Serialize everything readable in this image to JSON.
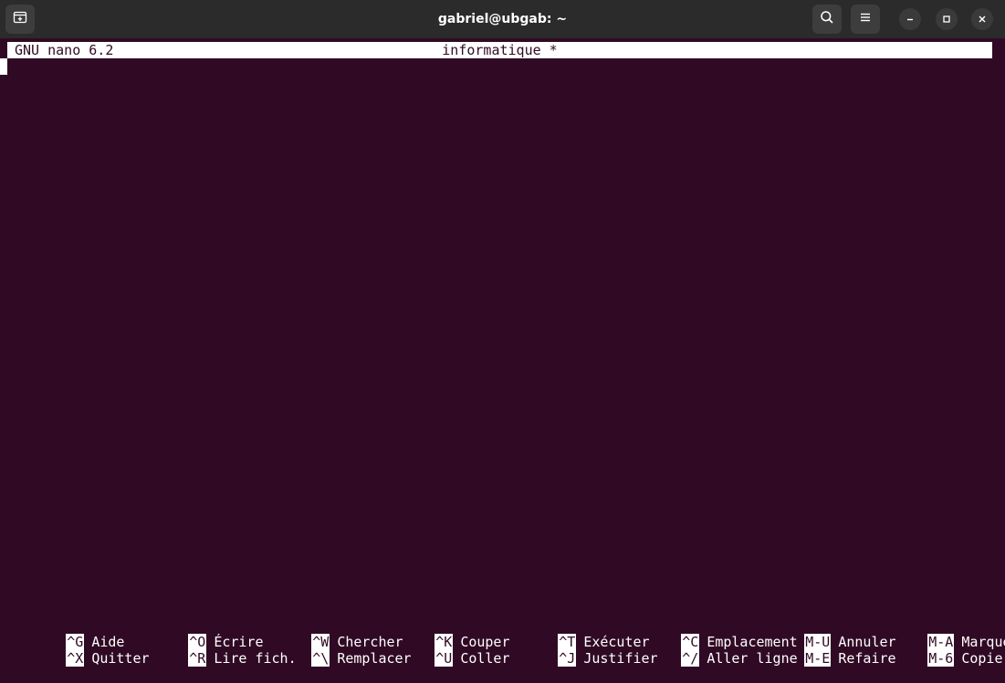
{
  "window": {
    "title": "gabriel@ubgab: ~",
    "new_tab_icon": "new-tab-icon",
    "search_icon": "search-icon",
    "menu_icon": "hamburger-menu-icon",
    "minimize_icon": "minimize-icon",
    "maximize_icon": "maximize-icon",
    "close_icon": "close-icon"
  },
  "nano": {
    "version": "GNU nano 6.2",
    "filename": "informatique *"
  },
  "shortcuts": {
    "row1": [
      {
        "key": "^G",
        "label": "Aide"
      },
      {
        "key": "^O",
        "label": "Écrire"
      },
      {
        "key": "^W",
        "label": "Chercher"
      },
      {
        "key": "^K",
        "label": "Couper"
      },
      {
        "key": "^T",
        "label": "Exécuter"
      },
      {
        "key": "^C",
        "label": "Emplacement"
      },
      {
        "key": "M-U",
        "label": "Annuler"
      },
      {
        "key": "M-A",
        "label": "Marquer"
      }
    ],
    "row2": [
      {
        "key": "^X",
        "label": "Quitter"
      },
      {
        "key": "^R",
        "label": "Lire fich."
      },
      {
        "key": "^\\",
        "label": "Remplacer"
      },
      {
        "key": "^U",
        "label": "Coller"
      },
      {
        "key": "^J",
        "label": "Justifier"
      },
      {
        "key": "^/",
        "label": "Aller ligne"
      },
      {
        "key": "M-E",
        "label": "Refaire"
      },
      {
        "key": "M-6",
        "label": "Copier"
      }
    ]
  },
  "colors": {
    "terminal_bg": "#300a24",
    "titlebar_bg": "#2b2b2b",
    "inverse_fg": "#ffffff"
  }
}
